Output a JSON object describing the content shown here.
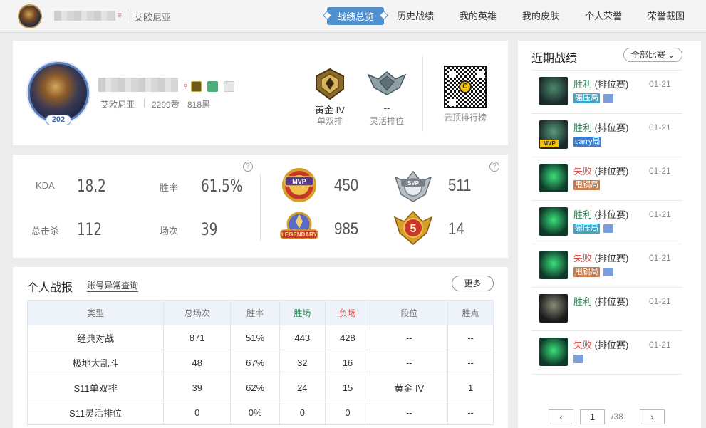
{
  "topbar": {
    "server": "艾欧尼亚",
    "gender_symbol": "♀",
    "nav": [
      "战绩总览",
      "历史战绩",
      "我的英雄",
      "我的皮肤",
      "个人荣誉",
      "荣誉截图"
    ],
    "active_nav": "战绩总览"
  },
  "profile": {
    "level": "202",
    "gender_symbol": "♀",
    "server": "艾欧尼亚",
    "likes": "2299赞",
    "black": "818黑",
    "solo_rank": {
      "title": "黄金 IV",
      "sub": "单双排"
    },
    "flex_rank": {
      "title": "--",
      "sub": "灵活排位"
    },
    "qr_label": "云顶排行榜"
  },
  "stats": {
    "kda_label": "KDA",
    "kda": "18.2",
    "winrate_label": "胜率",
    "winrate": "61.5%",
    "kills_label": "总击杀",
    "kills": "112",
    "games_label": "场次",
    "games": "39",
    "medals": {
      "mvp": "450",
      "svp": "511",
      "legendary": "985",
      "penta": "14"
    },
    "help_symbol": "?"
  },
  "record": {
    "title": "个人战报",
    "abnormal_link": "账号异常查询",
    "more": "更多",
    "headers": [
      "类型",
      "总场次",
      "胜率",
      "胜场",
      "负场",
      "段位",
      "胜点"
    ],
    "rows": [
      [
        "经典对战",
        "871",
        "51%",
        "443",
        "428",
        "--",
        "--"
      ],
      [
        "极地大乱斗",
        "48",
        "67%",
        "32",
        "16",
        "--",
        "--"
      ],
      [
        "S11单双排",
        "39",
        "62%",
        "24",
        "15",
        "黄金 IV",
        "1"
      ],
      [
        "S11灵活排位",
        "0",
        "0%",
        "0",
        "0",
        "--",
        "--"
      ]
    ]
  },
  "recent": {
    "title": "近期战绩",
    "filter": "全部比赛 ⌄",
    "mode": "(排位赛)",
    "matches": [
      {
        "result": "胜利",
        "date": "01-21",
        "tag": "碾压局",
        "tag_color": "#3aa7c9",
        "pic": true,
        "mvp": false
      },
      {
        "result": "胜利",
        "date": "01-21",
        "tag": "carry局",
        "tag_color": "#3a7fd0",
        "pic": false,
        "mvp": true
      },
      {
        "result": "失败",
        "date": "01-21",
        "tag": "甩锅局",
        "tag_color": "#c97a4a",
        "pic": false,
        "mvp": false
      },
      {
        "result": "胜利",
        "date": "01-21",
        "tag": "碾压局",
        "tag_color": "#3aa7c9",
        "pic": true,
        "mvp": false
      },
      {
        "result": "失败",
        "date": "01-21",
        "tag": "甩锅局",
        "tag_color": "#c97a4a",
        "pic": true,
        "mvp": false
      },
      {
        "result": "胜利",
        "date": "01-21",
        "tag": "",
        "tag_color": "",
        "pic": false,
        "mvp": false
      },
      {
        "result": "失败",
        "date": "01-21",
        "tag": "",
        "tag_color": "",
        "pic": true,
        "mvp": false
      }
    ],
    "pager": {
      "prev": "‹",
      "next": "›",
      "current": "1",
      "total": "/38"
    },
    "mvp_label": "MVP"
  }
}
